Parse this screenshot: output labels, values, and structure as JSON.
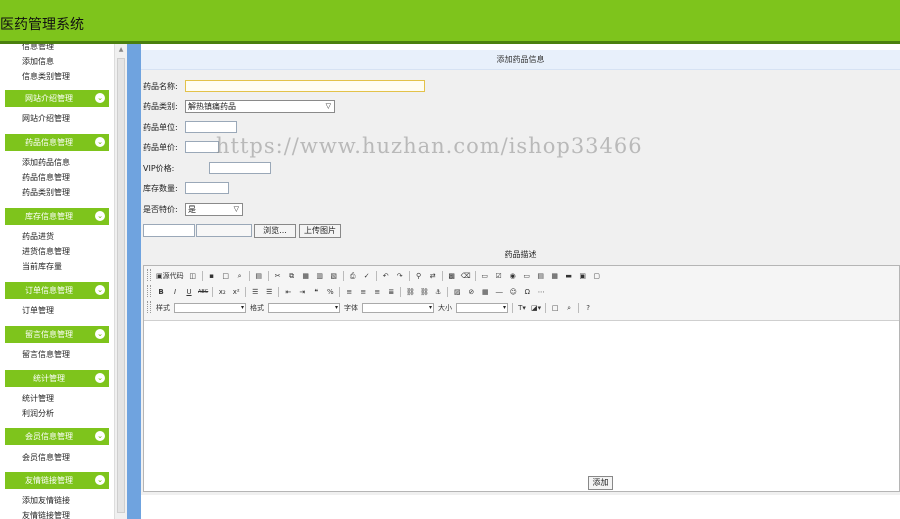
{
  "app": {
    "title": "医药管理系统"
  },
  "colors": {
    "header": "#7ec41c",
    "strip": "#6fa3df",
    "form_bg": "#f0f0f0",
    "title_bar": "#e8f0fb"
  },
  "sidebar": {
    "top_items": [
      "信息管理",
      "添加信息",
      "信息类别管理"
    ],
    "sections": [
      {
        "header": "网站介绍管理",
        "items": [
          "网站介绍管理"
        ]
      },
      {
        "header": "药品信息管理",
        "items": [
          "添加药品信息",
          "药品信息管理",
          "药品类别管理"
        ]
      },
      {
        "header": "库存信息管理",
        "items": [
          "药品进货",
          "进货信息管理",
          "当前库存量"
        ]
      },
      {
        "header": "订单信息管理",
        "items": [
          "订单管理"
        ]
      },
      {
        "header": "留言信息管理",
        "items": [
          "留言信息管理"
        ]
      },
      {
        "header": "统计管理",
        "items": [
          "统计管理",
          "利润分析"
        ]
      },
      {
        "header": "会员信息管理",
        "items": [
          "会员信息管理"
        ]
      },
      {
        "header": "友情链接管理",
        "items": [
          "添加友情链接",
          "友情链接管理"
        ]
      }
    ]
  },
  "form": {
    "title": "添加药品信息",
    "labels": {
      "name": "药品名称:",
      "category": "药品类别:",
      "unit": "药品单位:",
      "price": "药品单价:",
      "vip_price": "VIP价格:",
      "stock": "库存数量:",
      "special": "是否特价:"
    },
    "category_value": "解热镇痛药品",
    "special_value": "是",
    "browse_label": "浏览...",
    "upload_label": "上传图片",
    "desc_label": "药品描述",
    "submit_label": "添加"
  },
  "editor": {
    "source_label": "源代码",
    "style_label": "样式",
    "format_label": "格式",
    "font_label": "字体",
    "size_label": "大小",
    "bold": "B",
    "italic": "I",
    "underline": "U",
    "strike": "ABC"
  },
  "watermark": "https://www.huzhan.com/ishop33466"
}
